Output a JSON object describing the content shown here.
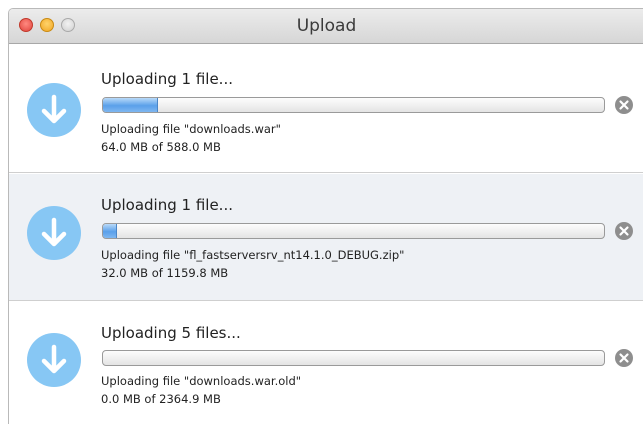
{
  "window": {
    "title": "Upload"
  },
  "uploads": [
    {
      "heading": "Uploading 1 file...",
      "file_text": "Uploading file \"downloads.war\"",
      "size_text": "64.0 MB of 588.0 MB",
      "progress": 0.109
    },
    {
      "heading": "Uploading 1 file...",
      "file_text": "Uploading file \"fl_fastserversrv_nt14.1.0_DEBUG.zip\"",
      "size_text": "32.0 MB of 1159.8 MB",
      "progress": 0.028
    },
    {
      "heading": "Uploading 5 files...",
      "file_text": "Uploading file \"downloads.war.old\"",
      "size_text": "0.0 MB of 2364.9 MB",
      "progress": 0.0
    }
  ],
  "icons": {
    "upload": "download-arrow-icon",
    "cancel": "cancel-x-icon"
  },
  "colors": {
    "icon_circle": "#87c7f4",
    "progress_fill": "#5aa0ea",
    "selected_row": "#eef1f5"
  }
}
